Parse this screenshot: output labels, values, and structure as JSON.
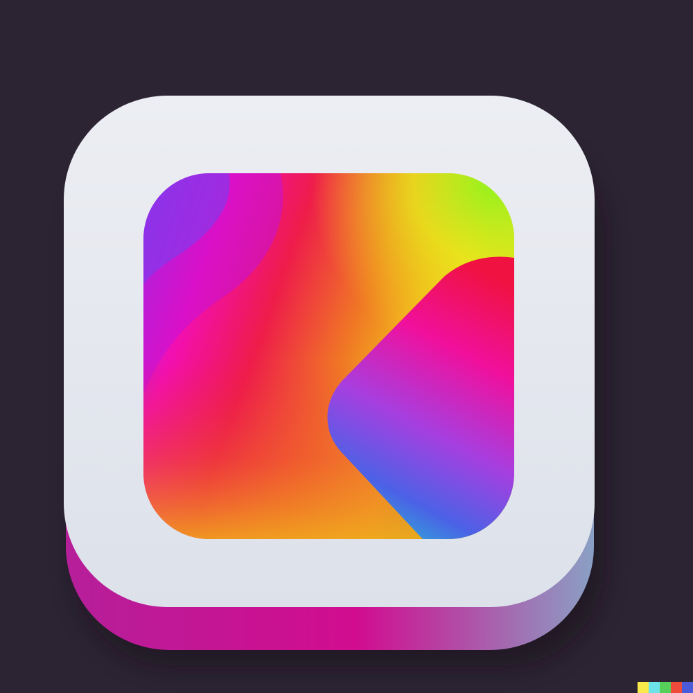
{
  "colors": {
    "background": "#2c2433",
    "tile_face": "#e5e8ef",
    "tile_edge_left": "#b61f9a",
    "tile_edge_mid": "#d10c8f",
    "tile_edge_right": "#8aa0c4",
    "gradient_purple": "#7a3df0",
    "gradient_magenta": "#f20fb3",
    "gradient_red": "#ee1c4a",
    "gradient_orange": "#f07a24",
    "gradient_yellow": "#f3d21a",
    "gradient_green": "#8ff21e",
    "blob_pink": "#f0109d",
    "blob_violet": "#a63fe0",
    "blob_blue": "#4b62e6",
    "blob_cyan": "#2ea8d8"
  },
  "icon": {
    "name": "gradient-app-icon"
  },
  "watermark": {
    "colors": [
      "#f7e94a",
      "#6ce3e8",
      "#57d05a",
      "#ee4b3a",
      "#4a5ad8"
    ]
  }
}
